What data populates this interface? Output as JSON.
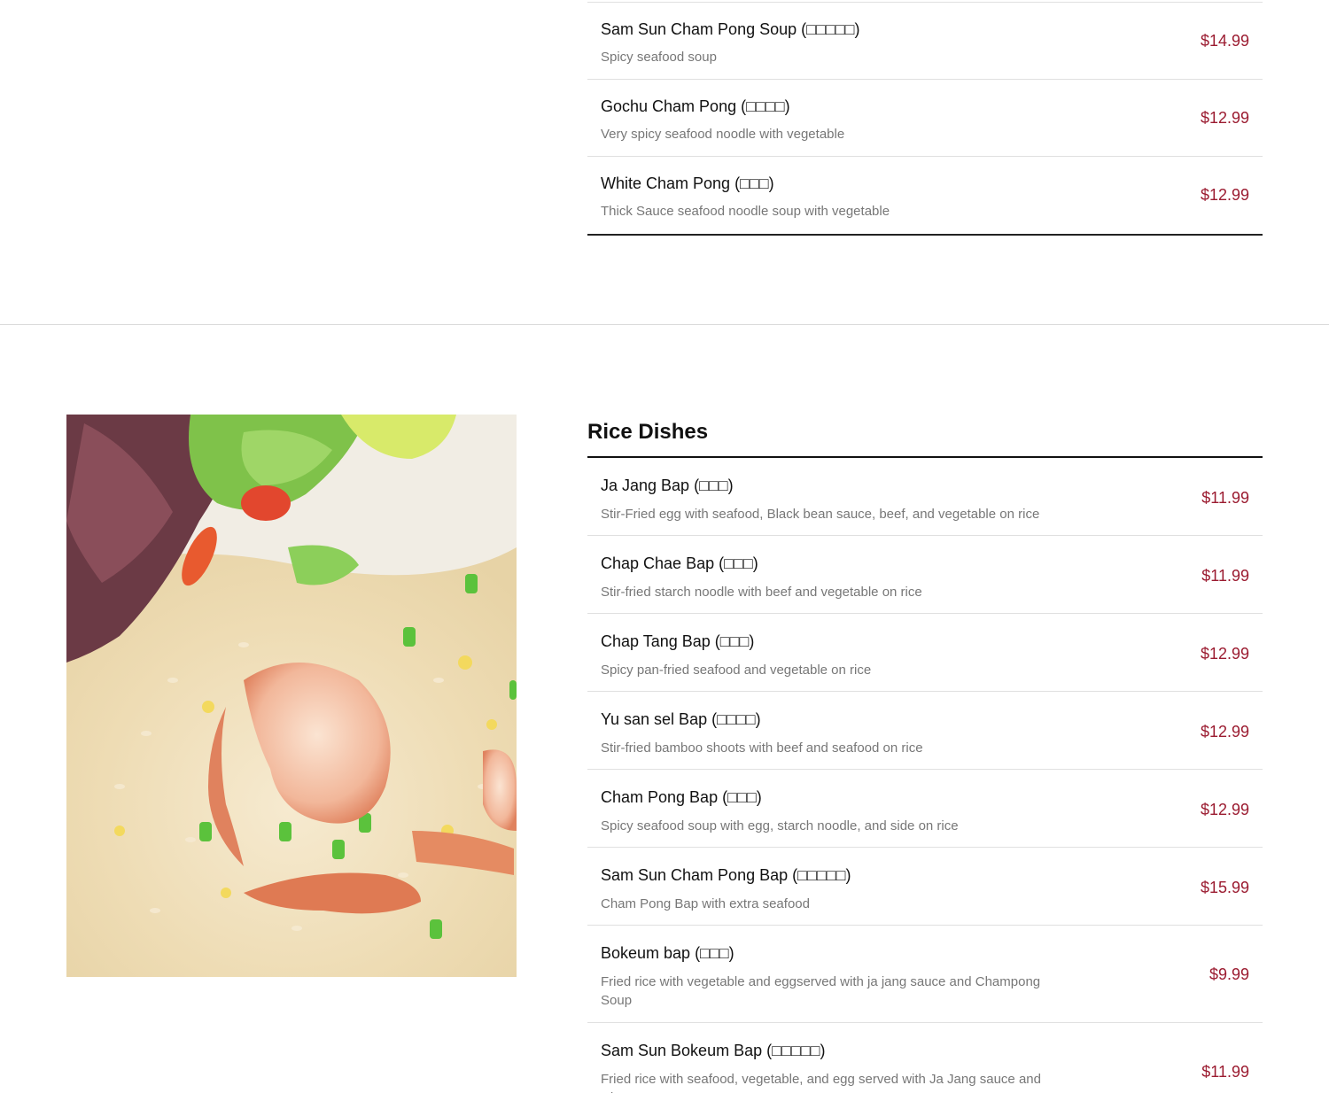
{
  "top_items": [
    {
      "name": "Sam Sun Cham Pong Soup (□□□□□)",
      "desc": "Spicy seafood soup",
      "price": "$14.99"
    },
    {
      "name": "Gochu Cham Pong (□□□□)",
      "desc": "Very spicy seafood noodle with vegetable",
      "price": "$12.99"
    },
    {
      "name": "White Cham Pong (□□□)",
      "desc": "Thick Sauce seafood noodle soup with vegetable",
      "price": "$12.99"
    }
  ],
  "rice_section": {
    "title": "Rice Dishes",
    "items": [
      {
        "name": "Ja Jang Bap (□□□)",
        "desc": "Stir-Fried egg with seafood, Black bean sauce, beef, and vegetable on rice",
        "price": "$11.99"
      },
      {
        "name": "Chap Chae Bap (□□□)",
        "desc": "Stir-fried starch noodle with beef and vegetable on rice",
        "price": "$11.99"
      },
      {
        "name": "Chap Tang Bap (□□□)",
        "desc": "Spicy pan-fried seafood and vegetable on rice",
        "price": "$12.99"
      },
      {
        "name": "Yu san sel Bap (□□□□)",
        "desc": "Stir-fried bamboo shoots with beef and seafood on rice",
        "price": "$12.99"
      },
      {
        "name": "Cham Pong Bap (□□□)",
        "desc": "Spicy seafood soup with egg, starch noodle, and side on rice",
        "price": "$12.99"
      },
      {
        "name": "Sam Sun Cham Pong Bap (□□□□□)",
        "desc": "Cham Pong Bap with extra seafood",
        "price": "$15.99"
      },
      {
        "name": "Bokeum bap (□□□)",
        "desc": "Fried rice with vegetable and eggserved with ja jang sauce and Champong Soup",
        "price": "$9.99"
      },
      {
        "name": "Sam Sun Bokeum Bap (□□□□□)",
        "desc": "Fried rice with seafood, vegetable, and egg served with Ja Jang sauce and Champong Soup",
        "price": "$11.99"
      }
    ]
  },
  "colors": {
    "price": "#9b1b30",
    "desc": "#777777"
  }
}
